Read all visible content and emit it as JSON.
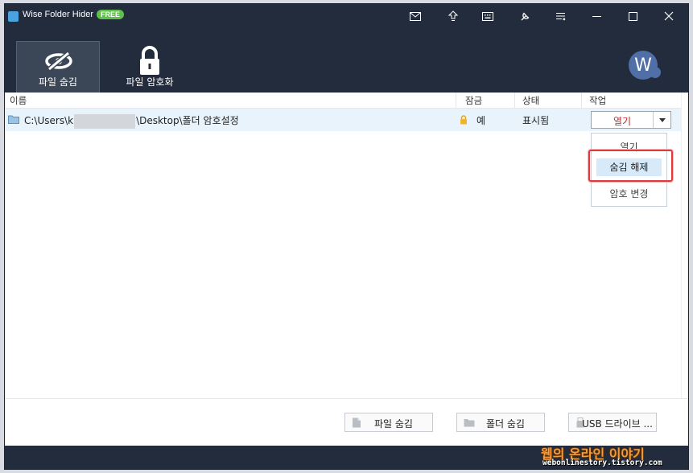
{
  "app": {
    "title": "Wise Folder Hider",
    "badge": "FREE"
  },
  "toolbar_icons": [
    "mail-icon",
    "upgrade-icon",
    "keyboard-icon",
    "tools-icon",
    "menu-icon"
  ],
  "tabs": [
    {
      "label": "파일 숨김",
      "icon": "eye-slash-icon",
      "active": true
    },
    {
      "label": "파일 암호화",
      "icon": "lock-icon",
      "active": false
    }
  ],
  "avatar": {
    "letter": "W"
  },
  "columns": {
    "name": "이름",
    "lock": "잠금",
    "state": "상태",
    "action": "작업"
  },
  "rows": [
    {
      "path_prefix": "C:\\Users\\k",
      "path_suffix": "\\Desktop\\폴더 암호설정",
      "lock": "예",
      "state": "표시됨",
      "action": "열기"
    }
  ],
  "dropdown": {
    "items": [
      "열기",
      "숨김 해제",
      "암호 변경"
    ],
    "selected": 1
  },
  "footer": {
    "hide_file": "파일 숨김",
    "hide_folder": "폴더 숨김",
    "usb": "USB 드라이브 ..."
  },
  "watermark": {
    "line1": "웹의 온라인 이야기",
    "line2": "webonlinestory.tistory.com"
  },
  "colors": {
    "titlebar": "#232c3d",
    "accent_red": "#c2282a",
    "badge_green": "#5ec24a",
    "row_highlight": "#e9f3fb"
  }
}
